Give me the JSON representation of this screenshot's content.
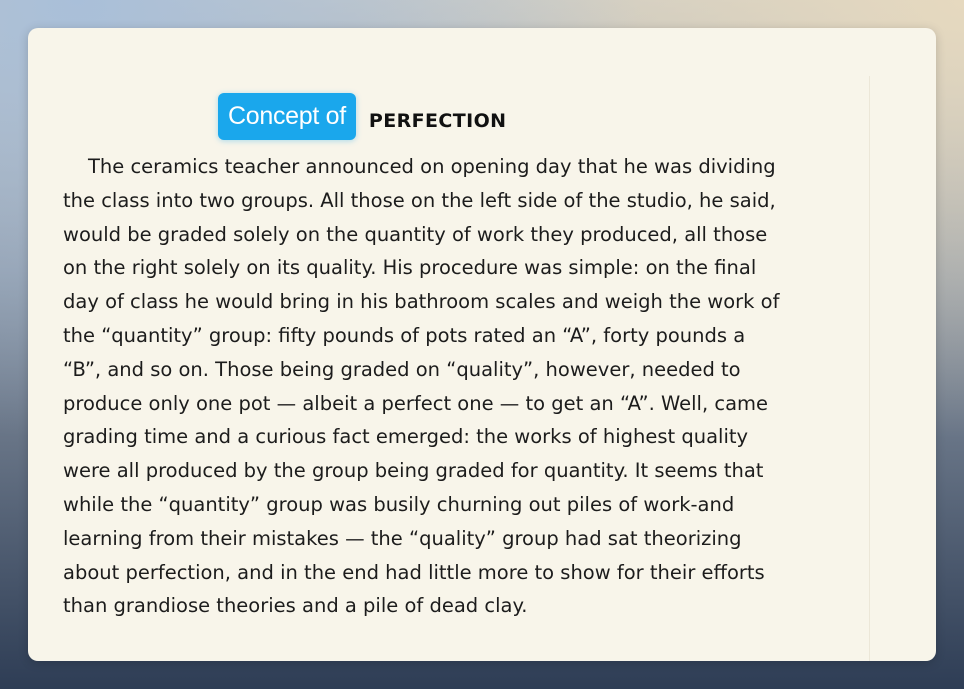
{
  "badge": {
    "label": "Concept of",
    "color": "#1aa7ec"
  },
  "heading": "PERFECTION",
  "paragraph_lines": [
    "The ceramics teacher announced on opening day that he was dividing",
    "the class into two groups. All those on the left side of the studio, he said,",
    "would be graded solely on the quantity of work they produced, all those",
    "on the right solely on its quality. His procedure was simple: on the final",
    "day of class he would bring in his bathroom scales and weigh the work of",
    "the “quantity” group: fifty pounds of pots rated an “A”, forty pounds a",
    "“B”, and so on. Those being graded on “quality”, however, needed to",
    "produce only one pot — albeit a perfect one — to get an “A”. Well, came",
    "grading time and a curious fact emerged: the works of highest quality",
    "were all produced by the group being graded for quantity. It seems that",
    "while the “quantity” group was busily churning out piles of work-and",
    "learning from their mistakes — the “quality” group had sat theorizing",
    "about perfection, and in the end had little more to show for their efforts",
    "than grandiose theories and a pile of dead clay."
  ]
}
